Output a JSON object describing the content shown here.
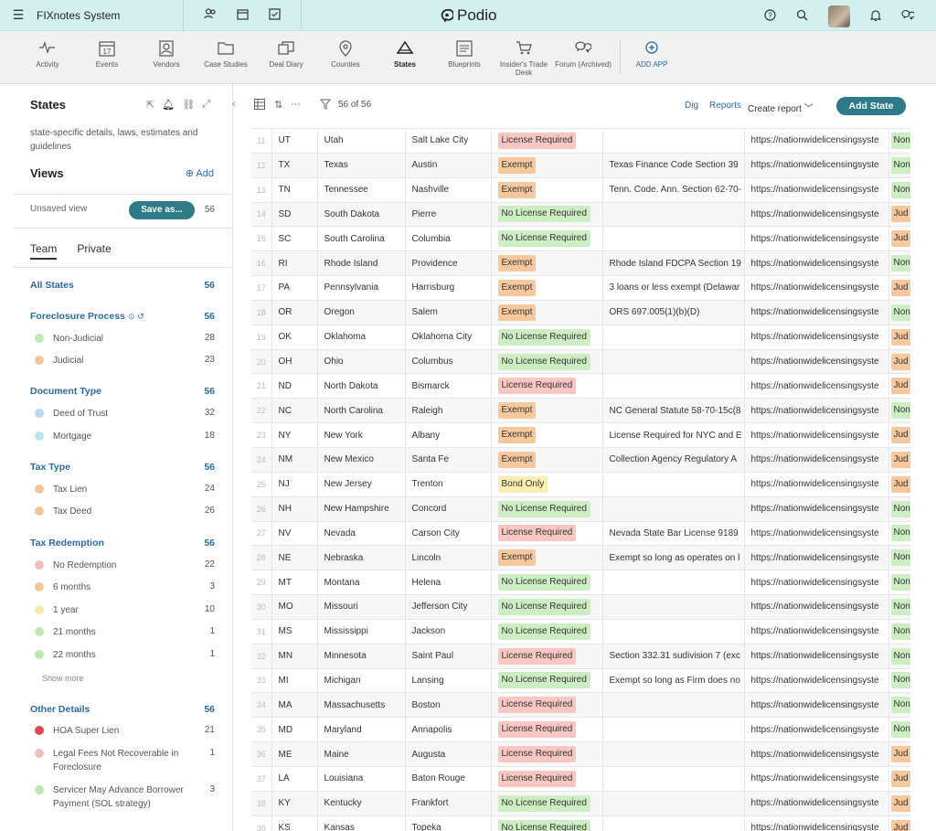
{
  "topbar": {
    "workspace": "FIXnotes System",
    "brand": "Podio"
  },
  "apps": [
    {
      "label": "Activity",
      "icon": "activity-icon"
    },
    {
      "label": "Events",
      "icon": "calendar-icon"
    },
    {
      "label": "Vendors",
      "icon": "contact-card-icon"
    },
    {
      "label": "Case Studies",
      "icon": "folder-icon"
    },
    {
      "label": "Deal Diary",
      "icon": "copy-icon"
    },
    {
      "label": "Counties",
      "icon": "map-pin-icon"
    },
    {
      "label": "States",
      "icon": "triangle-icon"
    },
    {
      "label": "Blueprints",
      "icon": "blueprint-icon"
    },
    {
      "label": "Insider's Trade Desk",
      "icon": "cart-icon"
    },
    {
      "label": "Forum (Archived)",
      "icon": "chat-icon"
    },
    {
      "label": "ADD APP",
      "icon": "plus-circle-icon"
    }
  ],
  "left": {
    "title": "States",
    "description": "state-specific details, laws, estimates and guidelines",
    "views_label": "Views",
    "add_label": "Add",
    "unsaved_label": "Unsaved view",
    "save_as_label": "Save as...",
    "unsaved_count": "56",
    "tabs": [
      "Team",
      "Private"
    ],
    "all_states": {
      "label": "All States",
      "count": "56"
    },
    "groups": {
      "foreclosure": {
        "label": "Foreclosure Process",
        "count": "56",
        "items": [
          {
            "label": "Non-Judicial",
            "count": "28",
            "color": "#bfe8b0"
          },
          {
            "label": "Judicial",
            "count": "23",
            "color": "#f5c59a"
          }
        ]
      },
      "document": {
        "label": "Document Type",
        "count": "56",
        "items": [
          {
            "label": "Deed of Trust",
            "count": "32",
            "color": "#bcd8f3"
          },
          {
            "label": "Mortgage",
            "count": "18",
            "color": "#b9e4ea"
          }
        ]
      },
      "tax": {
        "label": "Tax Type",
        "count": "56",
        "items": [
          {
            "label": "Tax Lien",
            "count": "24",
            "color": "#f5c59a"
          },
          {
            "label": "Tax Deed",
            "count": "26",
            "color": "#f5c59a"
          }
        ]
      },
      "redemption": {
        "label": "Tax Redemption",
        "count": "56",
        "items": [
          {
            "label": "No Redemption",
            "count": "22",
            "color": "#f6bcbc"
          },
          {
            "label": "6 months",
            "count": "3",
            "color": "#f5c59a"
          },
          {
            "label": "1 year",
            "count": "10",
            "color": "#f7e9a8"
          },
          {
            "label": "21 months",
            "count": "1",
            "color": "#bfe8b0"
          },
          {
            "label": "22 months",
            "count": "1",
            "color": "#bfe8b0"
          }
        ]
      },
      "show_more": "Show more",
      "other": {
        "label": "Other Details",
        "count": "56",
        "items": [
          {
            "label": "HOA Super Lien",
            "count": "21",
            "color": "#e0484f"
          },
          {
            "label": "Legal Fees Not Recoverable in Foreclosure",
            "count": "1",
            "color": "#f6bcbc"
          },
          {
            "label": "Servicer May Advance Borrower Payment (SOL strategy)",
            "count": "3",
            "color": "#bfe8b0"
          }
        ]
      }
    }
  },
  "toolbar": {
    "count_label": "56 of 56",
    "dig": "Dig",
    "reports": "Reports",
    "create_report": "Create report",
    "add_state": "Add State"
  },
  "table": {
    "url_text": "https://nationwidelicensingsyste",
    "rows": [
      {
        "n": "11",
        "abbr": "UT",
        "state": "Utah",
        "capital": "Salt Lake City",
        "license": "License Required",
        "status": "req",
        "note": "",
        "tag": "Non"
      },
      {
        "n": "12",
        "abbr": "TX",
        "state": "Texas",
        "capital": "Austin",
        "license": "Exempt",
        "status": "exe",
        "note": "Texas Finance Code Section 39",
        "tag": "Non"
      },
      {
        "n": "13",
        "abbr": "TN",
        "state": "Tennessee",
        "capital": "Nashville",
        "license": "Exempt",
        "status": "exe",
        "note": "Tenn. Code. Ann. Section 62-70-",
        "tag": "Non"
      },
      {
        "n": "14",
        "abbr": "SD",
        "state": "South Dakota",
        "capital": "Pierre",
        "license": "No License Required",
        "status": "nol",
        "note": "",
        "tag": "Jud"
      },
      {
        "n": "15",
        "abbr": "SC",
        "state": "South Carolina",
        "capital": "Columbia",
        "license": "No License Required",
        "status": "nol",
        "note": "",
        "tag": "Jud"
      },
      {
        "n": "16",
        "abbr": "RI",
        "state": "Rhode Island",
        "capital": "Providence",
        "license": "Exempt",
        "status": "exe",
        "note": "Rhode Island FDCPA Section 19",
        "tag": "Non"
      },
      {
        "n": "17",
        "abbr": "PA",
        "state": "Pennsylvania",
        "capital": "Harrisburg",
        "license": "Exempt",
        "status": "exe",
        "note": "3 loans or less exempt (Delawar",
        "tag": "Jud"
      },
      {
        "n": "18",
        "abbr": "OR",
        "state": "Oregon",
        "capital": "Salem",
        "license": "Exempt",
        "status": "exe",
        "note": "ORS 697.005(1)(b)(D)",
        "tag": "Non"
      },
      {
        "n": "19",
        "abbr": "OK",
        "state": "Oklahoma",
        "capital": "Oklahoma City",
        "license": "No License Required",
        "status": "nol",
        "note": "",
        "tag": "Jud"
      },
      {
        "n": "20",
        "abbr": "OH",
        "state": "Ohio",
        "capital": "Columbus",
        "license": "No License Required",
        "status": "nol",
        "note": "",
        "tag": "Jud"
      },
      {
        "n": "21",
        "abbr": "ND",
        "state": "North Dakota",
        "capital": "Bismarck",
        "license": "License Required",
        "status": "req",
        "note": "",
        "tag": "Jud"
      },
      {
        "n": "22",
        "abbr": "NC",
        "state": "North Carolina",
        "capital": "Raleigh",
        "license": "Exempt",
        "status": "exe",
        "note": "NC General Statute 58-70-15c(8",
        "tag": "Non"
      },
      {
        "n": "23",
        "abbr": "NY",
        "state": "New York",
        "capital": "Albany",
        "license": "Exempt",
        "status": "exe",
        "note": "License Required for NYC and E",
        "tag": "Jud"
      },
      {
        "n": "24",
        "abbr": "NM",
        "state": "New Mexico",
        "capital": "Santa Fe",
        "license": "Exempt",
        "status": "exe",
        "note": "Collection Agency Regulatory A",
        "tag": "Jud"
      },
      {
        "n": "25",
        "abbr": "NJ",
        "state": "New Jersey",
        "capital": "Trenton",
        "license": "Bond Only",
        "status": "bond",
        "note": "",
        "tag": "Jud"
      },
      {
        "n": "26",
        "abbr": "NH",
        "state": "New Hampshire",
        "capital": "Concord",
        "license": "No License Required",
        "status": "nol",
        "note": "",
        "tag": "Non"
      },
      {
        "n": "27",
        "abbr": "NV",
        "state": "Nevada",
        "capital": "Carson City",
        "license": "License Required",
        "status": "req",
        "note": "Nevada State Bar License 9189",
        "tag": "Non"
      },
      {
        "n": "28",
        "abbr": "NE",
        "state": "Nebraska",
        "capital": "Lincoln",
        "license": "Exempt",
        "status": "exe",
        "note": "Exempt so long as operates on l",
        "tag": "Non"
      },
      {
        "n": "29",
        "abbr": "MT",
        "state": "Montana",
        "capital": "Helena",
        "license": "No License Required",
        "status": "nol",
        "note": "",
        "tag": "Non"
      },
      {
        "n": "30",
        "abbr": "MO",
        "state": "Missouri",
        "capital": "Jefferson City",
        "license": "No License Required",
        "status": "nol",
        "note": "",
        "tag": "Non"
      },
      {
        "n": "31",
        "abbr": "MS",
        "state": "Mississippi",
        "capital": "Jackson",
        "license": "No License Required",
        "status": "nol",
        "note": "",
        "tag": "Non"
      },
      {
        "n": "32",
        "abbr": "MN",
        "state": "Minnesota",
        "capital": "Saint Paul",
        "license": "License Required",
        "status": "req",
        "note": "Section 332.31 sudivision 7 (exc",
        "tag": "Non"
      },
      {
        "n": "33",
        "abbr": "MI",
        "state": "Michigan",
        "capital": "Lansing",
        "license": "No License Required",
        "status": "nol",
        "note": "Exempt so long as Firm does no",
        "tag": "Non"
      },
      {
        "n": "34",
        "abbr": "MA",
        "state": "Massachusetts",
        "capital": "Boston",
        "license": "License Required",
        "status": "req",
        "note": "",
        "tag": "Non"
      },
      {
        "n": "35",
        "abbr": "MD",
        "state": "Maryland",
        "capital": "Annapolis",
        "license": "License Required",
        "status": "req",
        "note": "",
        "tag": "Non"
      },
      {
        "n": "36",
        "abbr": "ME",
        "state": "Maine",
        "capital": "Augusta",
        "license": "License Required",
        "status": "req",
        "note": "",
        "tag": "Jud"
      },
      {
        "n": "37",
        "abbr": "LA",
        "state": "Louisiana",
        "capital": "Baton Rouge",
        "license": "License Required",
        "status": "req",
        "note": "",
        "tag": "Jud"
      },
      {
        "n": "38",
        "abbr": "KY",
        "state": "Kentucky",
        "capital": "Frankfort",
        "license": "No License Required",
        "status": "nol",
        "note": "",
        "tag": "Jud"
      },
      {
        "n": "39",
        "abbr": "KS",
        "state": "Kansas",
        "capital": "Topeka",
        "license": "No License Required",
        "status": "nol",
        "note": "",
        "tag": "Jud"
      }
    ]
  }
}
